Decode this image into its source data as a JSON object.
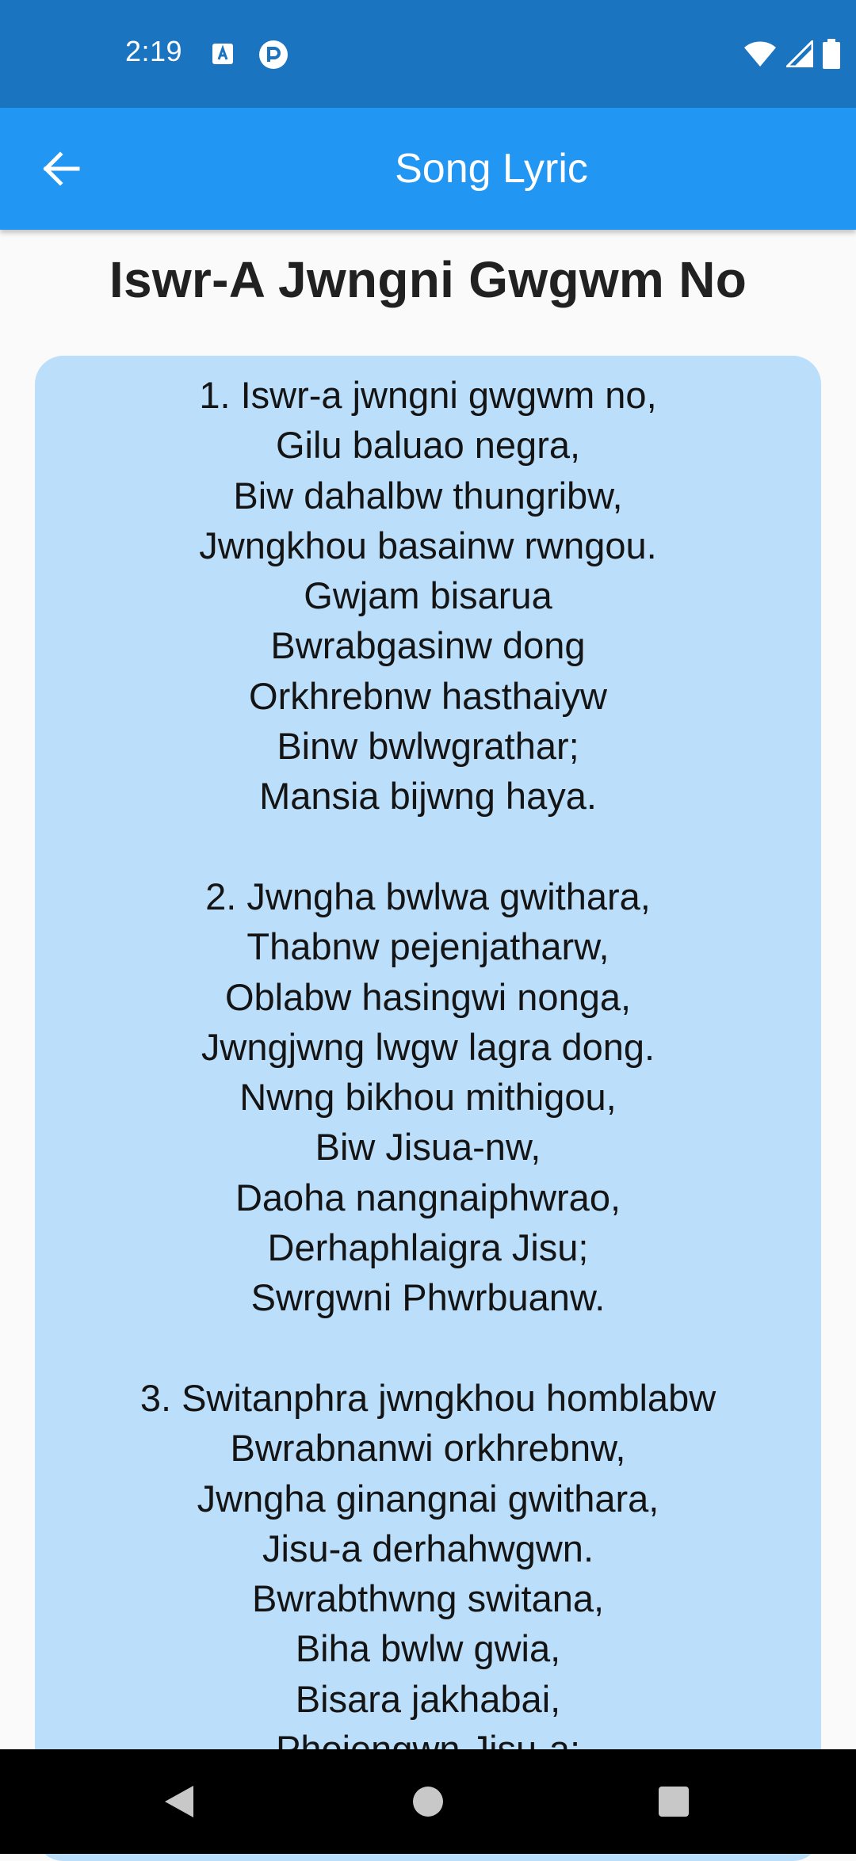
{
  "status_bar": {
    "time": "2:19",
    "icons": [
      "notification-a-icon",
      "notification-p-icon",
      "wifi-icon",
      "signal-icon",
      "battery-icon"
    ]
  },
  "app_bar": {
    "title": "Song Lyric",
    "back_icon": "arrow-back-icon"
  },
  "song": {
    "title": "Iswr-A Jwngni Gwgwm No",
    "lyrics": "1. Iswr-a jwngni gwgwm no,\nGilu baluao negra,\nBiw dahalbw thungribw,\nJwngkhou basainw rwngou.\nGwjam bisarua\nBwrabgasinw dong\nOrkhrebnw hasthaiyw\nBinw bwlwgrathar;\nMansia bijwng haya.\n\n2. Jwngha bwlwa gwithara,\nThabnw pejenjatharw,\nOblabw hasingwi nonga,\nJwngjwng lwgw lagra dong.\nNwng bikhou mithigou,\nBiw Jisua-nw,\nDaoha nangnaiphwrao,\nDerhaphlaigra Jisu;\nSwrgwni Phwrbuanw.\n\n3. Switanphra jwngkhou homblabw\nBwrabnanwi orkhrebnw,\nJwngha ginangnai gwithara,\nJisu-a derhahwgwn.\nBwrabthwng switana,\nBiha bwlw gwia,\nBisara jakhabai,\nPhojengwn Jisu-a;"
  },
  "colors": {
    "status_bar": "#1b74bf",
    "app_bar": "#2196f3",
    "card": "#bbdefb",
    "nav_bar": "#000000"
  },
  "nav_bar": {
    "buttons": [
      "back-triangle-icon",
      "home-circle-icon",
      "recents-square-icon"
    ]
  }
}
